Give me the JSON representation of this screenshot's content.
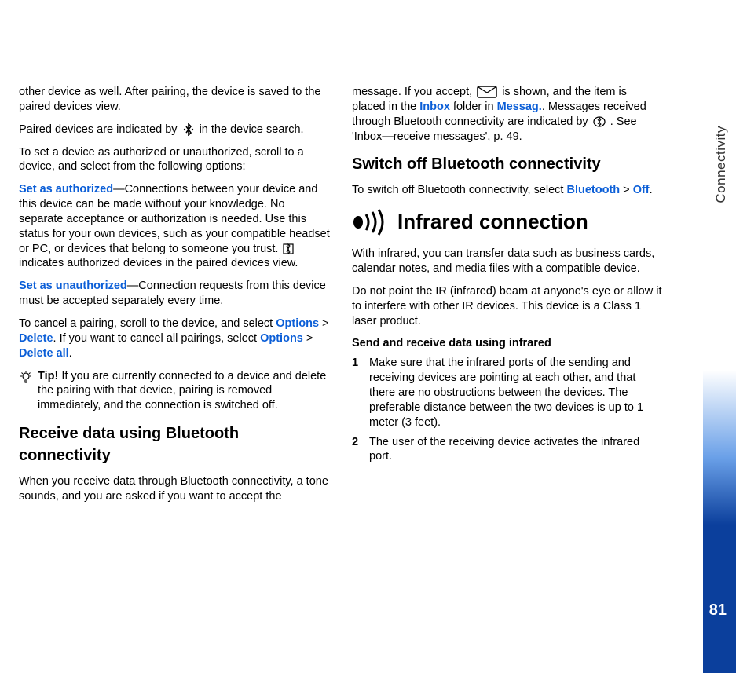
{
  "sidebar": {
    "label": "Connectivity",
    "page_number": "81"
  },
  "col1": {
    "p1": "other device as well. After pairing, the device is saved to the paired devices view.",
    "p2_a": "Paired devices are indicated by ",
    "p2_b": " in the device search.",
    "p3": "To set a device as authorized or unauthorized, scroll to a device, and select from the following options:",
    "auth_label": "Set as authorized",
    "p4_a": "—Connections between your device and this device can be made without your knowledge. No separate acceptance or authorization is needed. Use this status for your own devices, such as your compatible headset or PC, or devices that belong to someone you trust. ",
    "p4_b": " indicates authorized devices in the paired devices view.",
    "unauth_label": "Set as unauthorized",
    "p5": "—Connection requests from this device must be accepted separately every time.",
    "p6_a": "To cancel a pairing, scroll to the device, and select ",
    "options": "Options",
    "gt": " > ",
    "delete": "Delete",
    "p6_b": ". If you want to cancel all pairings, select ",
    "delete_all": "Delete all",
    "period": ".",
    "tip_bold": "Tip!",
    "tip_body": " If you are currently connected to a device and delete the pairing with that device, pairing is removed immediately, and the connection is switched off.",
    "h2_receive": "Receive data using Bluetooth connectivity",
    "p7": "When you receive data through Bluetooth connectivity, a tone sounds, and you are asked if you want to accept the"
  },
  "col2": {
    "p1_a": "message. If you accept, ",
    "p1_b": " is shown, and the item is placed in the ",
    "inbox": "Inbox",
    "p1_c": " folder in ",
    "messag": "Messag.",
    "p1_d": ". Messages received through Bluetooth connectivity are indicated by ",
    "p1_e": ". See 'Inbox—receive messages', p. 49.",
    "h2_switch": "Switch off Bluetooth connectivity",
    "p2_a": "To switch off Bluetooth connectivity, select ",
    "bluetooth": "Bluetooth",
    "off": "Off",
    "ir_heading": "Infrared connection",
    "p3": "With infrared, you can transfer data such as business cards, calendar notes, and media files with a compatible device.",
    "p4": "Do not point the IR (infrared) beam at anyone's eye or allow it to interfere with other IR devices. This device is a Class 1 laser product.",
    "subhead": "Send and receive data using infrared",
    "step1": "Make sure that the infrared ports of the sending and receiving devices are pointing at each other, and that there are no obstructions between the devices. The preferable distance between the two devices is up to 1 meter (3 feet).",
    "step2": "The user of the receiving device activates the infrared port."
  }
}
